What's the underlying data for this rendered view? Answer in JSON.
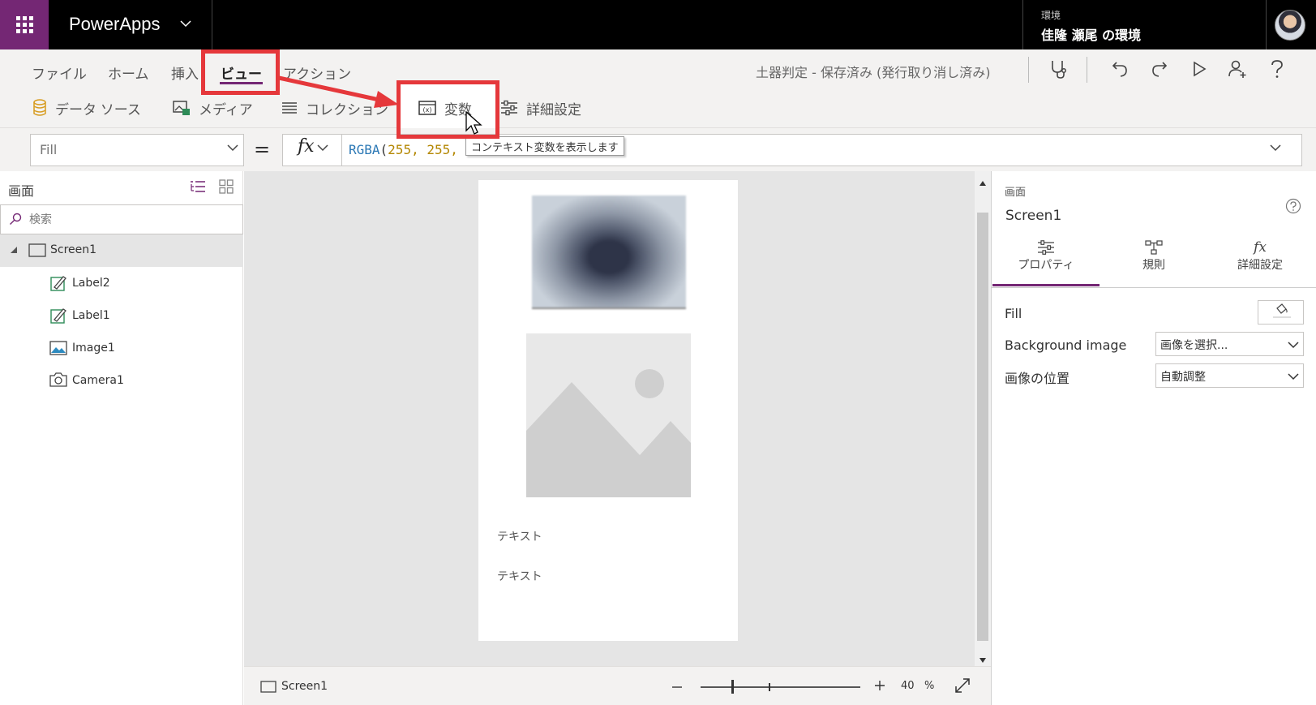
{
  "app": {
    "name": "PowerApps",
    "environment_label": "環境",
    "environment_name": "佳隆 瀬尾 の環境"
  },
  "menu": {
    "items": [
      "ファイル",
      "ホーム",
      "挿入",
      "ビュー",
      "アクション"
    ],
    "active": "ビュー"
  },
  "status": {
    "save_text": "土器判定 - 保存済み (発行取り消し済み)"
  },
  "ribbon": {
    "items": [
      "データ ソース",
      "メディア",
      "コレクション",
      "変数",
      "詳細設定"
    ]
  },
  "formula_bar": {
    "property": "Fill",
    "equals": "=",
    "fx_label": "fx",
    "formula_fn": "RGBA",
    "formula_args": "255, 255,",
    "tooltip": "コンテキスト変数を表示します"
  },
  "tree": {
    "title": "画面",
    "search_placeholder": "検索",
    "screen": "Screen1",
    "controls": [
      "Label2",
      "Label1",
      "Image1",
      "Camera1"
    ]
  },
  "canvas": {
    "labels": [
      "テキスト",
      "テキスト"
    ]
  },
  "bottom_bar": {
    "screen": "Screen1",
    "zoom_value": "40",
    "zoom_unit": "%"
  },
  "right_panel": {
    "type_label": "画面",
    "name": "Screen1",
    "tabs": [
      "プロパティ",
      "規則",
      "詳細設定"
    ],
    "active_tab": "プロパティ",
    "fill_label": "Fill",
    "background_image_label": "Background image",
    "background_image_value": "画像を選択...",
    "image_position_label": "画像の位置",
    "image_position_value": "自動調整"
  },
  "colors": {
    "accent": "#742774",
    "annotation_red": "#e5383b",
    "formula_fn": "#2b78b5",
    "formula_num": "#b38600"
  }
}
